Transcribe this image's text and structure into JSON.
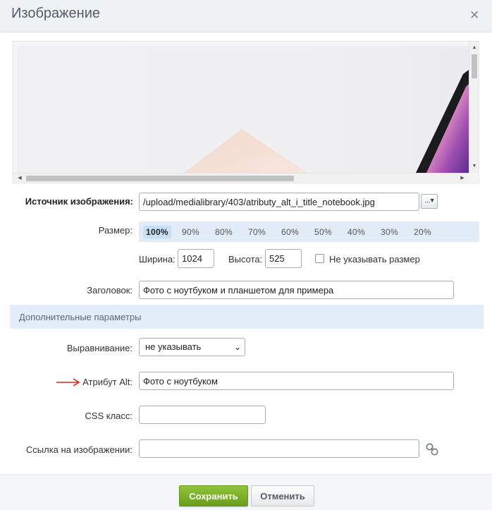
{
  "dialog": {
    "title": "Изображение",
    "close_icon": "close-icon",
    "close_glyph": "✕"
  },
  "preview": {
    "scroll_left": "◀",
    "scroll_right": "▶",
    "scroll_up": "▲",
    "scroll_down": "▼"
  },
  "source": {
    "label": "Источник изображения:",
    "value": "/upload/medialibrary/403/atributy_alt_i_title_notebook.jpg",
    "browse_label": "...▾"
  },
  "size": {
    "label": "Размер:",
    "options": [
      "100%",
      "90%",
      "80%",
      "70%",
      "60%",
      "50%",
      "40%",
      "30%",
      "20%"
    ],
    "selected": "100%",
    "width_label": "Ширина:",
    "width_value": "1024",
    "height_label": "Высота:",
    "height_value": "525",
    "no_size_label": "Не указывать размер"
  },
  "heading": {
    "label": "Заголовок:",
    "value": "Фото с ноутбуком и планшетом для примера"
  },
  "additional": {
    "title": "Дополнительные параметры"
  },
  "align": {
    "label": "Выравнивание:",
    "value": "не указывать"
  },
  "alt": {
    "label": "Атрибут Alt:",
    "value": "Фото с ноутбуком",
    "arrow_color": "#e02020"
  },
  "css_class": {
    "label": "CSS класс:",
    "value": ""
  },
  "image_link": {
    "label": "Ссылка на изображении:",
    "value": "",
    "icon": "link-icon"
  },
  "buttons": {
    "save": "Сохранить",
    "cancel": "Отменить"
  },
  "colors": {
    "save_button": "#7cb227",
    "section_bg": "#e3edf8",
    "titlebar_bg": "#eef2f4"
  }
}
